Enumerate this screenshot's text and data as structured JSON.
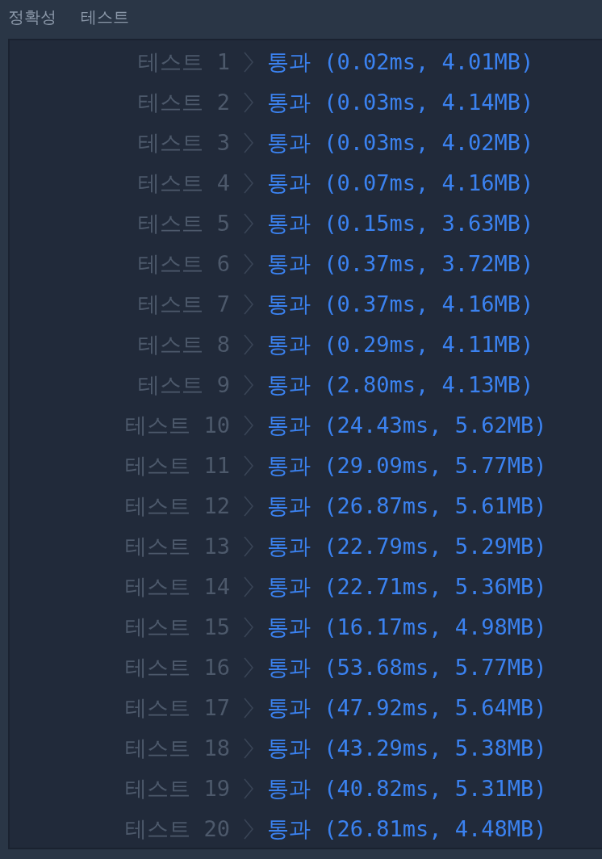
{
  "header": {
    "labels": [
      "정확성",
      "테스트"
    ]
  },
  "results": [
    {
      "label": "테스트 1",
      "result": "통과 (0.02ms, 4.01MB)"
    },
    {
      "label": "테스트 2",
      "result": "통과 (0.03ms, 4.14MB)"
    },
    {
      "label": "테스트 3",
      "result": "통과 (0.03ms, 4.02MB)"
    },
    {
      "label": "테스트 4",
      "result": "통과 (0.07ms, 4.16MB)"
    },
    {
      "label": "테스트 5",
      "result": "통과 (0.15ms, 3.63MB)"
    },
    {
      "label": "테스트 6",
      "result": "통과 (0.37ms, 3.72MB)"
    },
    {
      "label": "테스트 7",
      "result": "통과 (0.37ms, 4.16MB)"
    },
    {
      "label": "테스트 8",
      "result": "통과 (0.29ms, 4.11MB)"
    },
    {
      "label": "테스트 9",
      "result": "통과 (2.80ms, 4.13MB)"
    },
    {
      "label": "테스트 10",
      "result": "통과 (24.43ms, 5.62MB)"
    },
    {
      "label": "테스트 11",
      "result": "통과 (29.09ms, 5.77MB)"
    },
    {
      "label": "테스트 12",
      "result": "통과 (26.87ms, 5.61MB)"
    },
    {
      "label": "테스트 13",
      "result": "통과 (22.79ms, 5.29MB)"
    },
    {
      "label": "테스트 14",
      "result": "통과 (22.71ms, 5.36MB)"
    },
    {
      "label": "테스트 15",
      "result": "통과 (16.17ms, 4.98MB)"
    },
    {
      "label": "테스트 16",
      "result": "통과 (53.68ms, 5.77MB)"
    },
    {
      "label": "테스트 17",
      "result": "통과 (47.92ms, 5.64MB)"
    },
    {
      "label": "테스트 18",
      "result": "통과 (43.29ms, 5.38MB)"
    },
    {
      "label": "테스트 19",
      "result": "통과 (40.82ms, 5.31MB)"
    },
    {
      "label": "테스트 20",
      "result": "통과 (26.81ms, 4.48MB)"
    }
  ]
}
